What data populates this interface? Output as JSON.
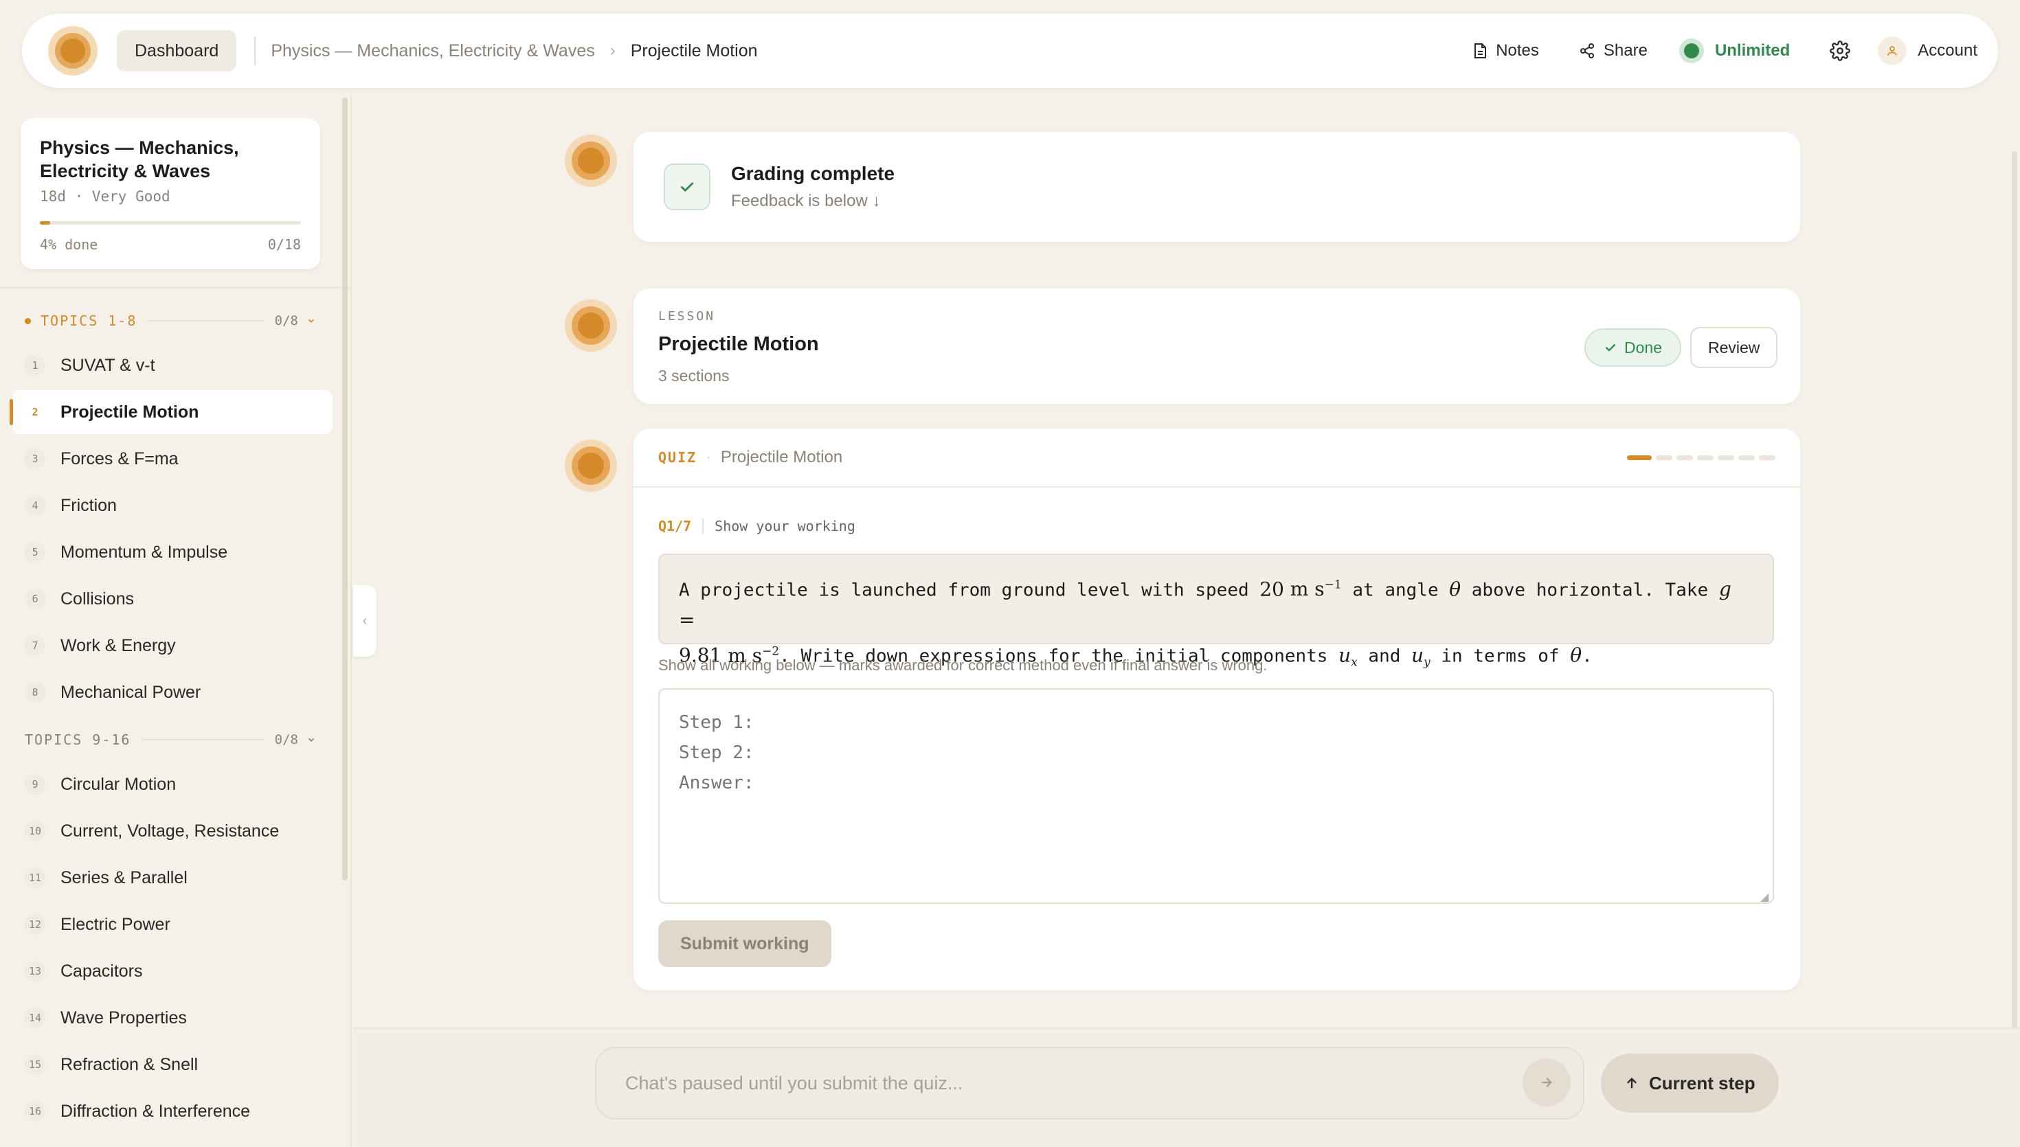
{
  "header": {
    "dashboard_label": "Dashboard",
    "breadcrumb_course": "Physics — Mechanics, Electricity & Waves",
    "breadcrumb_separator": "›",
    "breadcrumb_current": "Projectile Motion",
    "notes_label": "Notes",
    "share_label": "Share",
    "plan_label": "Unlimited",
    "account_label": "Account"
  },
  "course": {
    "title": "Physics — Mechanics, Electricity & Waves",
    "meta": "18d · Very Good",
    "progress_fraction": 0.04,
    "progress_text": "4% done",
    "progress_count": "0/18"
  },
  "groups": [
    {
      "label": "TOPICS 1-8",
      "count": "0/8",
      "active": true
    },
    {
      "label": "TOPICS 9-16",
      "count": "0/8",
      "active": false
    }
  ],
  "topics": [
    {
      "num": "1",
      "label": "SUVAT & v-t"
    },
    {
      "num": "2",
      "label": "Projectile Motion",
      "active": true
    },
    {
      "num": "3",
      "label": "Forces & F=ma"
    },
    {
      "num": "4",
      "label": "Friction"
    },
    {
      "num": "5",
      "label": "Momentum & Impulse"
    },
    {
      "num": "6",
      "label": "Collisions"
    },
    {
      "num": "7",
      "label": "Work & Energy"
    },
    {
      "num": "8",
      "label": "Mechanical Power"
    },
    {
      "num": "9",
      "label": "Circular Motion"
    },
    {
      "num": "10",
      "label": "Current, Voltage, Resistance"
    },
    {
      "num": "11",
      "label": "Series & Parallel"
    },
    {
      "num": "12",
      "label": "Electric Power"
    },
    {
      "num": "13",
      "label": "Capacitors"
    },
    {
      "num": "14",
      "label": "Wave Properties"
    },
    {
      "num": "15",
      "label": "Refraction & Snell"
    },
    {
      "num": "16",
      "label": "Diffraction & Interference"
    }
  ],
  "grading": {
    "title": "Grading complete",
    "subtitle": "Feedback is below ↓"
  },
  "lesson": {
    "label": "LESSON",
    "title": "Projectile Motion",
    "sections": "3 sections",
    "done_label": "Done",
    "review_label": "Review"
  },
  "quiz": {
    "tag": "QUIZ",
    "separator": "·",
    "name": "Projectile Motion",
    "current_question": 1,
    "total_questions": 7,
    "question_number": "Q1/7",
    "question_hint": "Show your working",
    "question_parts": {
      "t1": "A projectile is launched from ground level with speed ",
      "speed": "20",
      "t2": " at angle ",
      "theta": "θ",
      "t3": " above horizontal. Take ",
      "g": "g",
      "eq": " =",
      "gval": "9.81",
      "t4": ". Write down expressions for the initial components ",
      "ux": "u",
      "ux_sub": "x",
      "and": " and ",
      "uy": "u",
      "uy_sub": "y",
      "t5": " in terms of ",
      "theta2": "θ",
      "end": "."
    },
    "working_hint": "Show all working below — marks awarded for correct method even if final answer is wrong.",
    "working_placeholder": "Step 1:\nStep 2:\nAnswer:",
    "submit_label": "Submit working"
  },
  "chat": {
    "placeholder": "Chat's paused until you submit the quiz...",
    "current_step_label": "Current step"
  },
  "colors": {
    "accent": "#d58a2a",
    "success": "#2f8a4b",
    "background": "#f5f0e8"
  }
}
